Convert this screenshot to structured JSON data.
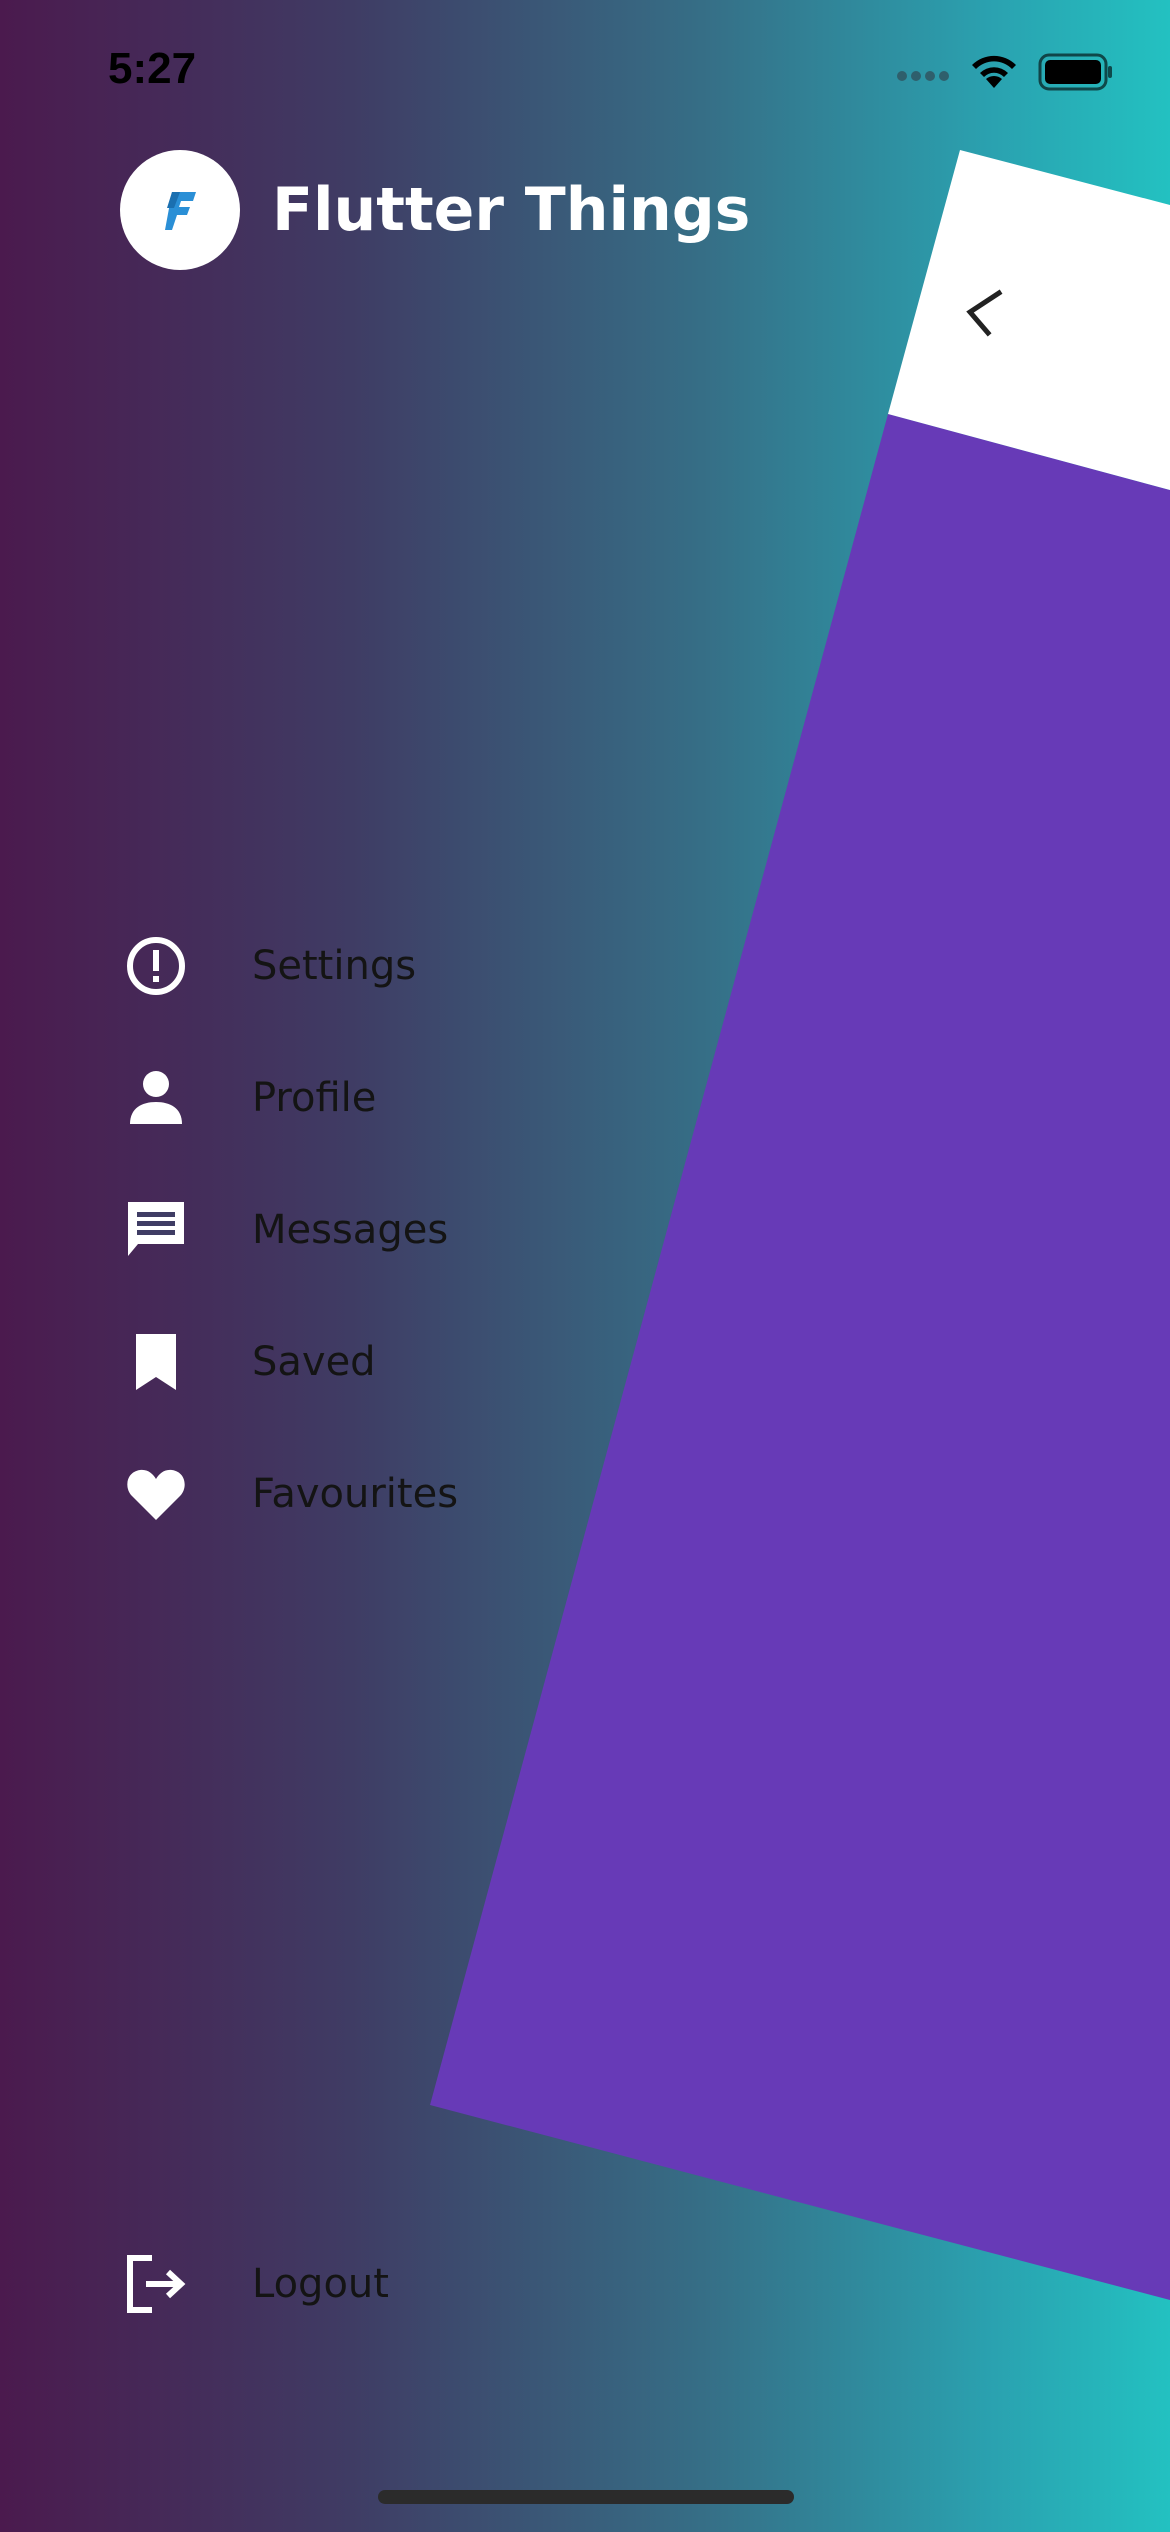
{
  "status_bar": {
    "time": "5:27"
  },
  "header": {
    "title": "Flutter Things",
    "logo_letter": "F"
  },
  "menu": {
    "items": [
      {
        "label": "Settings",
        "icon": "alert-circle-icon"
      },
      {
        "label": "Profile",
        "icon": "person-icon"
      },
      {
        "label": "Messages",
        "icon": "message-icon"
      },
      {
        "label": "Saved",
        "icon": "bookmark-icon"
      },
      {
        "label": "Favourites",
        "icon": "heart-icon"
      }
    ],
    "logout_label": "Logout"
  },
  "colors": {
    "gradient_left": "#4b1a4e",
    "gradient_right": "#23c1c1",
    "preview_body": "#673ab7",
    "preview_appbar": "#ffffff",
    "logo_blue": "#2a8fd6"
  }
}
